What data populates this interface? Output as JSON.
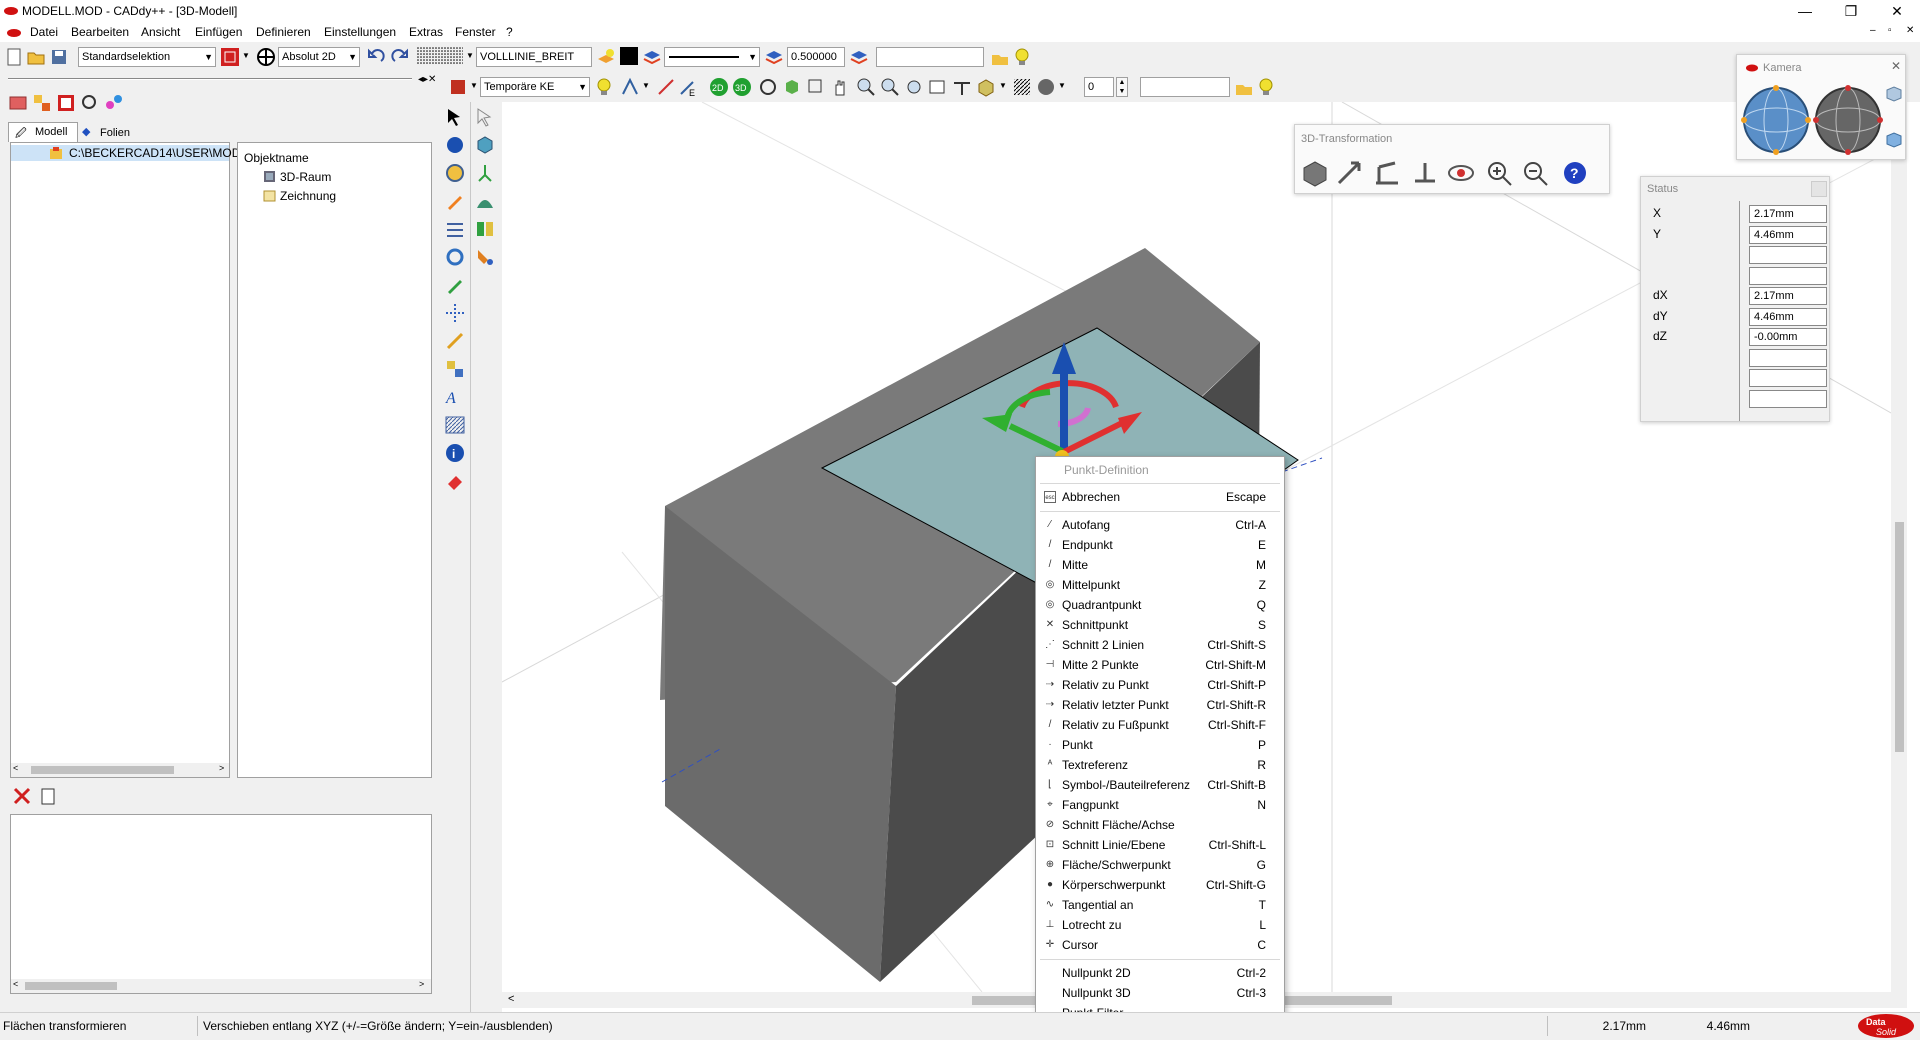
{
  "window": {
    "title": "MODELL.MOD  -  CADdy++ - [3D-Modell]",
    "minimize": "—",
    "maximize": "❐",
    "close": "✕"
  },
  "menu": [
    "Datei",
    "Bearbeiten",
    "Ansicht",
    "Einfügen",
    "Definieren",
    "Einstellungen",
    "Extras",
    "Fenster",
    "?"
  ],
  "toolbar1": {
    "selection_mode": "Standardselektion",
    "coord_mode": "Absolut 2D",
    "line_type": "VOLLLINIE_BREIT",
    "line_width": "0.500000",
    "layer_field": ""
  },
  "toolbar2": {
    "ke_mode": "Temporäre KE",
    "counter": "0",
    "field": ""
  },
  "left_panel": {
    "tabs": [
      "Modell",
      "Folien"
    ],
    "path": "C:\\BECKERCAD14\\USER\\MOD",
    "object_header": "Objektname",
    "objects": [
      "3D-Raum",
      "Zeichnung"
    ]
  },
  "transform_panel": {
    "title": "3D-Transformation"
  },
  "camera_panel": {
    "title": "Kamera"
  },
  "status_panel": {
    "title": "Status",
    "rows": [
      {
        "label": "X",
        "value": "2.17mm"
      },
      {
        "label": "Y",
        "value": "4.46mm"
      },
      {
        "label": "",
        "value": ""
      },
      {
        "label": "",
        "value": ""
      },
      {
        "label": "dX",
        "value": "2.17mm"
      },
      {
        "label": "dY",
        "value": "4.46mm"
      },
      {
        "label": "dZ",
        "value": "-0.00mm"
      },
      {
        "label": "",
        "value": ""
      },
      {
        "label": "",
        "value": ""
      },
      {
        "label": "",
        "value": ""
      }
    ]
  },
  "context_menu": {
    "title": "Punkt-Definition",
    "groups": [
      [
        {
          "icon": "esc",
          "label": "Abbrechen",
          "shortcut": "Escape"
        }
      ],
      [
        {
          "icon": "autofang",
          "label": "Autofang",
          "shortcut": "Ctrl-A"
        },
        {
          "icon": "endpoint",
          "label": "Endpunkt",
          "shortcut": "E"
        },
        {
          "icon": "midpoint",
          "label": "Mitte",
          "shortcut": "M"
        },
        {
          "icon": "center",
          "label": "Mittelpunkt",
          "shortcut": "Z"
        },
        {
          "icon": "quadrant",
          "label": "Quadrantpunkt",
          "shortcut": "Q"
        },
        {
          "icon": "intersection",
          "label": "Schnittpunkt",
          "shortcut": "S"
        },
        {
          "icon": "intersect2",
          "label": "Schnitt 2 Linien",
          "shortcut": "Ctrl-Shift-S"
        },
        {
          "icon": "mid2",
          "label": "Mitte 2 Punkte",
          "shortcut": "Ctrl-Shift-M"
        },
        {
          "icon": "relpoint",
          "label": "Relativ zu Punkt",
          "shortcut": "Ctrl-Shift-P"
        },
        {
          "icon": "rellast",
          "label": "Relativ letzter Punkt",
          "shortcut": "Ctrl-Shift-R"
        },
        {
          "icon": "relfoot",
          "label": "Relativ zu Fußpunkt",
          "shortcut": "Ctrl-Shift-F"
        },
        {
          "icon": "point",
          "label": "Punkt",
          "shortcut": "P"
        },
        {
          "icon": "textref",
          "label": "Textreferenz",
          "shortcut": "R"
        },
        {
          "icon": "symref",
          "label": "Symbol-/Bauteilreferenz",
          "shortcut": "Ctrl-Shift-B"
        },
        {
          "icon": "snap",
          "label": "Fangpunkt",
          "shortcut": "N"
        },
        {
          "icon": "faceaxis",
          "label": "Schnitt Fläche/Achse",
          "shortcut": ""
        },
        {
          "icon": "lineplane",
          "label": "Schnitt Linie/Ebene",
          "shortcut": "Ctrl-Shift-L"
        },
        {
          "icon": "centroid",
          "label": "Fläche/Schwerpunkt",
          "shortcut": "G"
        },
        {
          "icon": "bodycentroid",
          "label": "Körperschwerpunkt",
          "shortcut": "Ctrl-Shift-G"
        },
        {
          "icon": "tangent",
          "label": "Tangential an",
          "shortcut": "T"
        },
        {
          "icon": "perp",
          "label": "Lotrecht zu",
          "shortcut": "L"
        },
        {
          "icon": "cursor",
          "label": "Cursor",
          "shortcut": "C"
        }
      ],
      [
        {
          "icon": "",
          "label": "Nullpunkt 2D",
          "shortcut": "Ctrl-2"
        },
        {
          "icon": "",
          "label": "Nullpunkt 3D",
          "shortcut": "Ctrl-3"
        },
        {
          "icon": "",
          "label": "Punkt-Filter",
          "shortcut": ""
        }
      ]
    ]
  },
  "statusbar": {
    "left": "Flächen transformieren",
    "hint": "Verschieben entlang XYZ (+/-=Größe ändern; Y=ein-/ausblenden)",
    "x": "2.17mm",
    "y": "4.46mm"
  },
  "colors": {
    "cube_top": "#7a7a7a",
    "cube_left": "#666666",
    "cube_right": "#4a4a4a",
    "selected_face": "#8fb3b6",
    "axis_x": "#e03030",
    "axis_y": "#30b030",
    "axis_z": "#1a4fb0"
  }
}
